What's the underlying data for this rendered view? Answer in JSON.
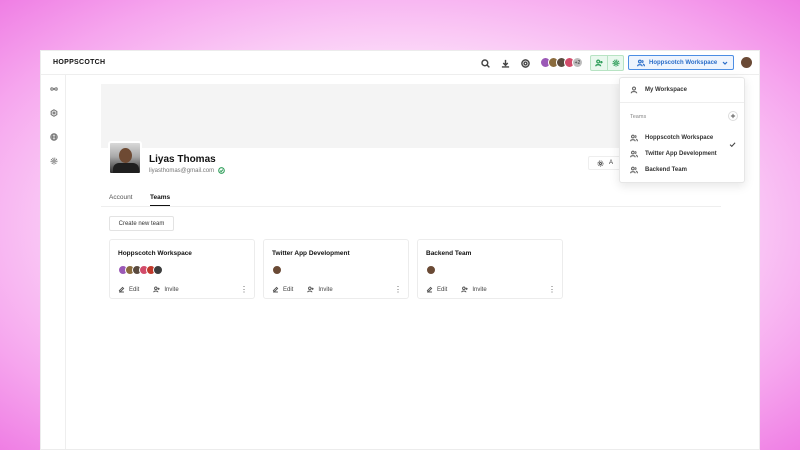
{
  "app": {
    "brand": "HOPPSCOTCH"
  },
  "header": {
    "collaborators": [
      {
        "initial": "",
        "color": "#9b59b6"
      },
      {
        "initial": "",
        "color": "#8a6b3d"
      },
      {
        "initial": "",
        "color": "#5a4a3e"
      },
      {
        "initial": "",
        "color": "#d24b6a"
      },
      {
        "initial": "+2",
        "color": "#bdbdbd"
      }
    ],
    "workspace_button": "Hoppscotch Workspace"
  },
  "profile": {
    "name": "Liyas Thomas",
    "email": "liyasthomas@gmail.com",
    "settings_label": "A"
  },
  "tabs": [
    {
      "label": "Account",
      "active": false
    },
    {
      "label": "Teams",
      "active": true
    }
  ],
  "create_team_label": "Create new team",
  "teams": [
    {
      "name": "Hoppscotch Workspace",
      "members": [
        "#9b59b6",
        "#8a6b3d",
        "#5a4a3e",
        "#d24b6a",
        "#c0392b",
        "#3d3d3d"
      ],
      "edit_label": "Edit",
      "invite_label": "Invite"
    },
    {
      "name": "Twitter App Development",
      "members": [
        "#6a4a35"
      ],
      "edit_label": "Edit",
      "invite_label": "Invite"
    },
    {
      "name": "Backend Team",
      "members": [
        "#6a4a35"
      ],
      "edit_label": "Edit",
      "invite_label": "Invite"
    }
  ],
  "dropdown": {
    "my_workspace": "My Workspace",
    "teams_label": "Teams",
    "items": [
      {
        "label": "Hoppscotch Workspace",
        "selected": true
      },
      {
        "label": "Twitter App Development",
        "selected": false
      },
      {
        "label": "Backend Team",
        "selected": false
      }
    ]
  },
  "colors": {
    "accent_blue": "#2a6dc9",
    "accent_green": "#2f9e5a"
  }
}
